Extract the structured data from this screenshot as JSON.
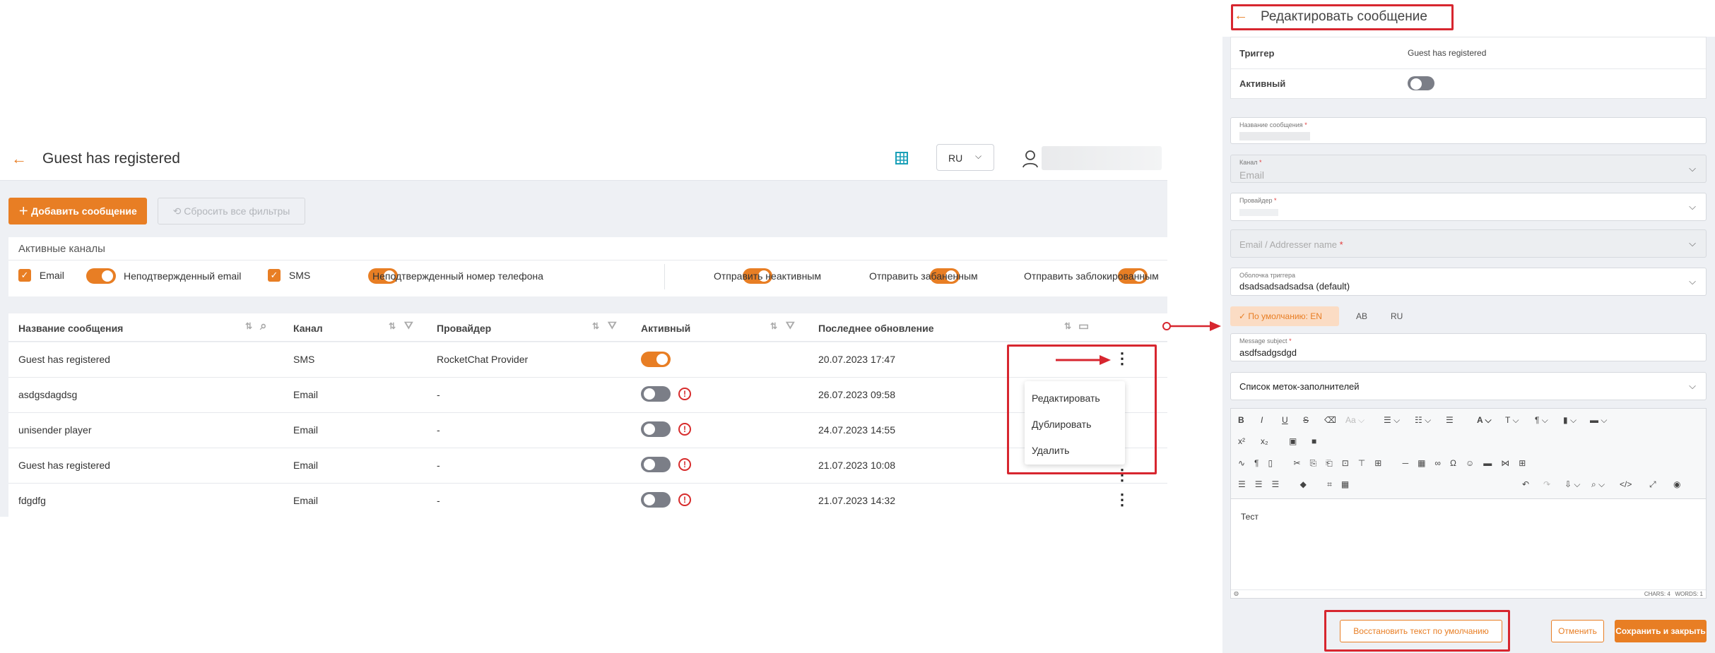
{
  "left": {
    "header": {
      "title": "Guest has registered",
      "lang": "RU"
    },
    "toolbar": {
      "add_label": "Добавить сообщение",
      "reset_label": "Сбросить все фильтры"
    },
    "channels": {
      "title": "Активные каналы",
      "email": "Email",
      "unconfirmed_email": "Неподтвержденный email",
      "sms": "SMS",
      "unconfirmed_phone": "Неподтвержденный номер телефона",
      "send_inactive": "Отправить неактивным",
      "send_banned": "Отправить забаненным",
      "send_blocked": "Отправить заблокированным"
    },
    "table": {
      "columns": [
        "Название сообщения",
        "Канал",
        "Провайдер",
        "Активный",
        "Последнее обновление"
      ],
      "rows": [
        {
          "name": "Guest has registered",
          "channel": "SMS",
          "provider": "RocketChat Provider",
          "active": true,
          "updated": "20.07.2023 17:47"
        },
        {
          "name": "asdgsdagdsg",
          "channel": "Email",
          "provider": "-",
          "active": false,
          "updated": "26.07.2023 09:58"
        },
        {
          "name": "unisender player",
          "channel": "Email",
          "provider": "-",
          "active": false,
          "updated": "24.07.2023 14:55"
        },
        {
          "name": "Guest has registered",
          "channel": "Email",
          "provider": "-",
          "active": false,
          "updated": "21.07.2023 10:08"
        },
        {
          "name": "fdgdfg",
          "channel": "Email",
          "provider": "-",
          "active": false,
          "updated": "21.07.2023 14:32"
        }
      ]
    },
    "menu": {
      "edit": "Редактировать",
      "duplicate": "Дублировать",
      "delete": "Удалить"
    }
  },
  "right": {
    "title": "Редактировать сообщение",
    "trigger_label": "Триггер",
    "trigger_value": "Guest has registered",
    "active_label": "Активный",
    "name_label": "Название сообщения",
    "channel_label": "Канал",
    "channel_value": "Email",
    "provider_label": "Провайдер",
    "addresser_placeholder": "Email / Addresser name",
    "shell_label": "Оболочка триггера",
    "shell_value": "dsadsadsadsadsa (default)",
    "lang_tabs": {
      "default": "По умолчанию: EN",
      "ab": "AB",
      "ru": "RU"
    },
    "subject_label": "Message subject",
    "subject_value": "asdfsadgsdgd",
    "placeholders_label": "Список меток-заполнителей",
    "editor_text": "Тест",
    "editor_stats": "CHARS: 4   WORDS: 1",
    "buttons": {
      "restore": "Восстановить текст по умолчанию",
      "cancel": "Отменить",
      "save": "Сохранить и закрыть"
    }
  },
  "colors": {
    "accent": "#e87e24",
    "annotation": "#d7262f"
  }
}
